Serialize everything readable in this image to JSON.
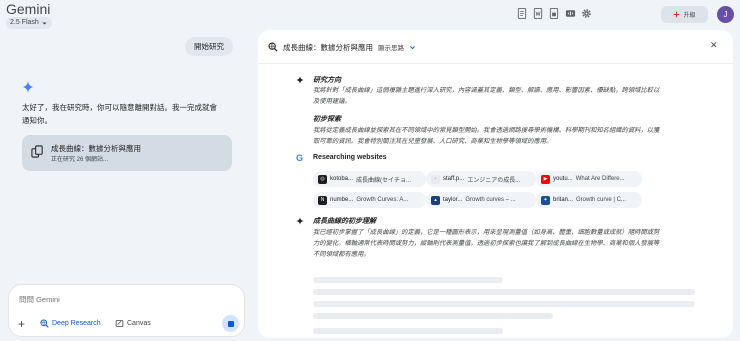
{
  "app": {
    "title": "Gemini",
    "model": "2.5 Flash"
  },
  "topbar": {
    "upgrade_label": "升級",
    "avatar_initial": "J"
  },
  "chat": {
    "user_message": "開始研究",
    "reply_line1": "太好了，我在研究時，你可以隨意離開對話。我一完成就會",
    "reply_line2": "通知你。",
    "card_title": "成長曲線：數據分析與應用",
    "card_status": "正在研究 26 個網站..."
  },
  "composer": {
    "placeholder": "問問 Gemini",
    "deep_research_label": "Deep Research",
    "canvas_label": "Canvas"
  },
  "panel": {
    "title": "成長曲線：數據分析與應用",
    "toggle_label": "顯示思路",
    "sections": [
      {
        "title": "研究方向",
        "line1": "我將針對「成長曲線」這個複雜主題進行深入研究，內容涵蓋其定義、類型、解讀、應用、影響因素、優缺點，跨領域比較以",
        "line2": "及使用建議。"
      },
      {
        "title": "初步探索",
        "line1": "我將從定義成長曲線並探索其在不同領域中的常見類型開始。我會透過網路搜尋學術機構、科學期刊和知名組織的資料，以獲",
        "line2": "取可靠的資訊。我會特別關注其在兒童發展、人口研究、商業和生物學等領域的應用。"
      }
    ],
    "websites_title": "Researching websites",
    "websites": [
      {
        "host": "kotoba...",
        "title": "成長曲線(セイチョ..."
      },
      {
        "host": "staff.p...",
        "title": "エンジニアの成長..."
      },
      {
        "host": "youtu...",
        "title": "What Are Differe..."
      },
      {
        "host": "numbe...",
        "title": "Growth Curves: A..."
      },
      {
        "host": "taylor...",
        "title": "Growth curves – ..."
      },
      {
        "host": "britan...",
        "title": "Growth curve | C..."
      }
    ],
    "understanding": {
      "title": "成長曲線的初步理解",
      "line1": "我已經初步掌握了「成長曲線」的定義，它是一種圖形表示，用來呈現測量值（如身高、體重、細胞數量或成就）隨時間或努",
      "line2": "力的變化。橫軸通常代表時間或努力，縱軸則代表測量值。透過初步探索也讓我了解到成長曲線在生物學、商業和個人發展等",
      "line3": "不同領域都有應用。"
    }
  }
}
